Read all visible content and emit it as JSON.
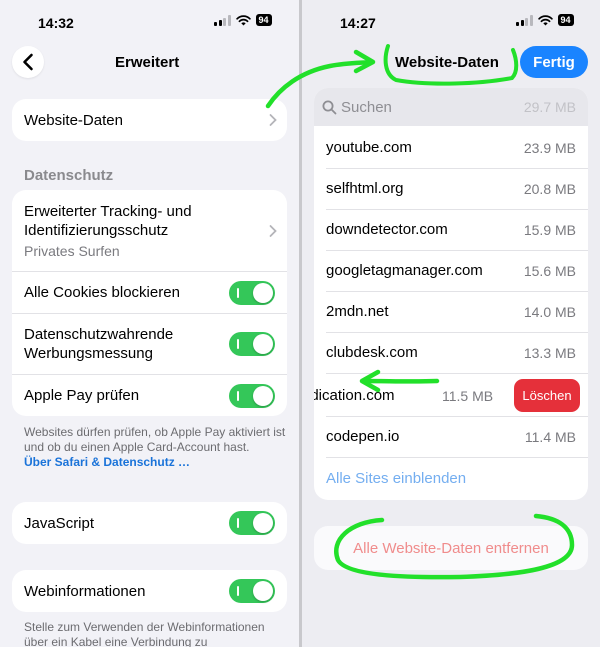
{
  "left": {
    "status": {
      "time": "14:32",
      "battery": "94"
    },
    "title": "Erweitert",
    "website_data": "Website-Daten",
    "privacy_header": "Datenschutz",
    "tracking": {
      "label": "Erweiterter Tracking- und Identifizierungsschutz",
      "sub": "Privates Surfen"
    },
    "cookies": "Alle Cookies blockieren",
    "ads": "Datenschutzwahrende Werbungsmessung",
    "applepay": "Apple Pay prüfen",
    "footnote": "Websites dürfen prüfen, ob Apple Pay aktiviert ist und ob du einen Apple Card-Account hast.",
    "footnote_link": "Über Safari & Datenschutz …",
    "javascript": "JavaScript",
    "webinfo": "Webinformationen",
    "webinfo_note": "Stelle zum Verwenden der Webinformationen über ein Kabel eine Verbindung zu"
  },
  "right": {
    "status": {
      "time": "14:27",
      "battery": "94"
    },
    "title": "Website-Daten",
    "done": "Fertig",
    "search_placeholder": "Suchen",
    "search_ghost": "29.7 MB",
    "sites": [
      {
        "name": "youtube.com",
        "size": "23.9 MB"
      },
      {
        "name": "selfhtml.org",
        "size": "20.8 MB"
      },
      {
        "name": "downdetector.com",
        "size": "15.9 MB"
      },
      {
        "name": "googletagmanager.com",
        "size": "15.6 MB"
      },
      {
        "name": "2mdn.net",
        "size": "14.0 MB"
      },
      {
        "name": "clubdesk.com",
        "size": "13.3 MB"
      },
      {
        "name": "ndication.com",
        "size": "11.5 MB"
      },
      {
        "name": "codepen.io",
        "size": "11.4 MB"
      }
    ],
    "delete_label": "Löschen",
    "show_all": "Alle Sites einblenden",
    "remove_all": "Alle Website-Daten entfernen"
  }
}
